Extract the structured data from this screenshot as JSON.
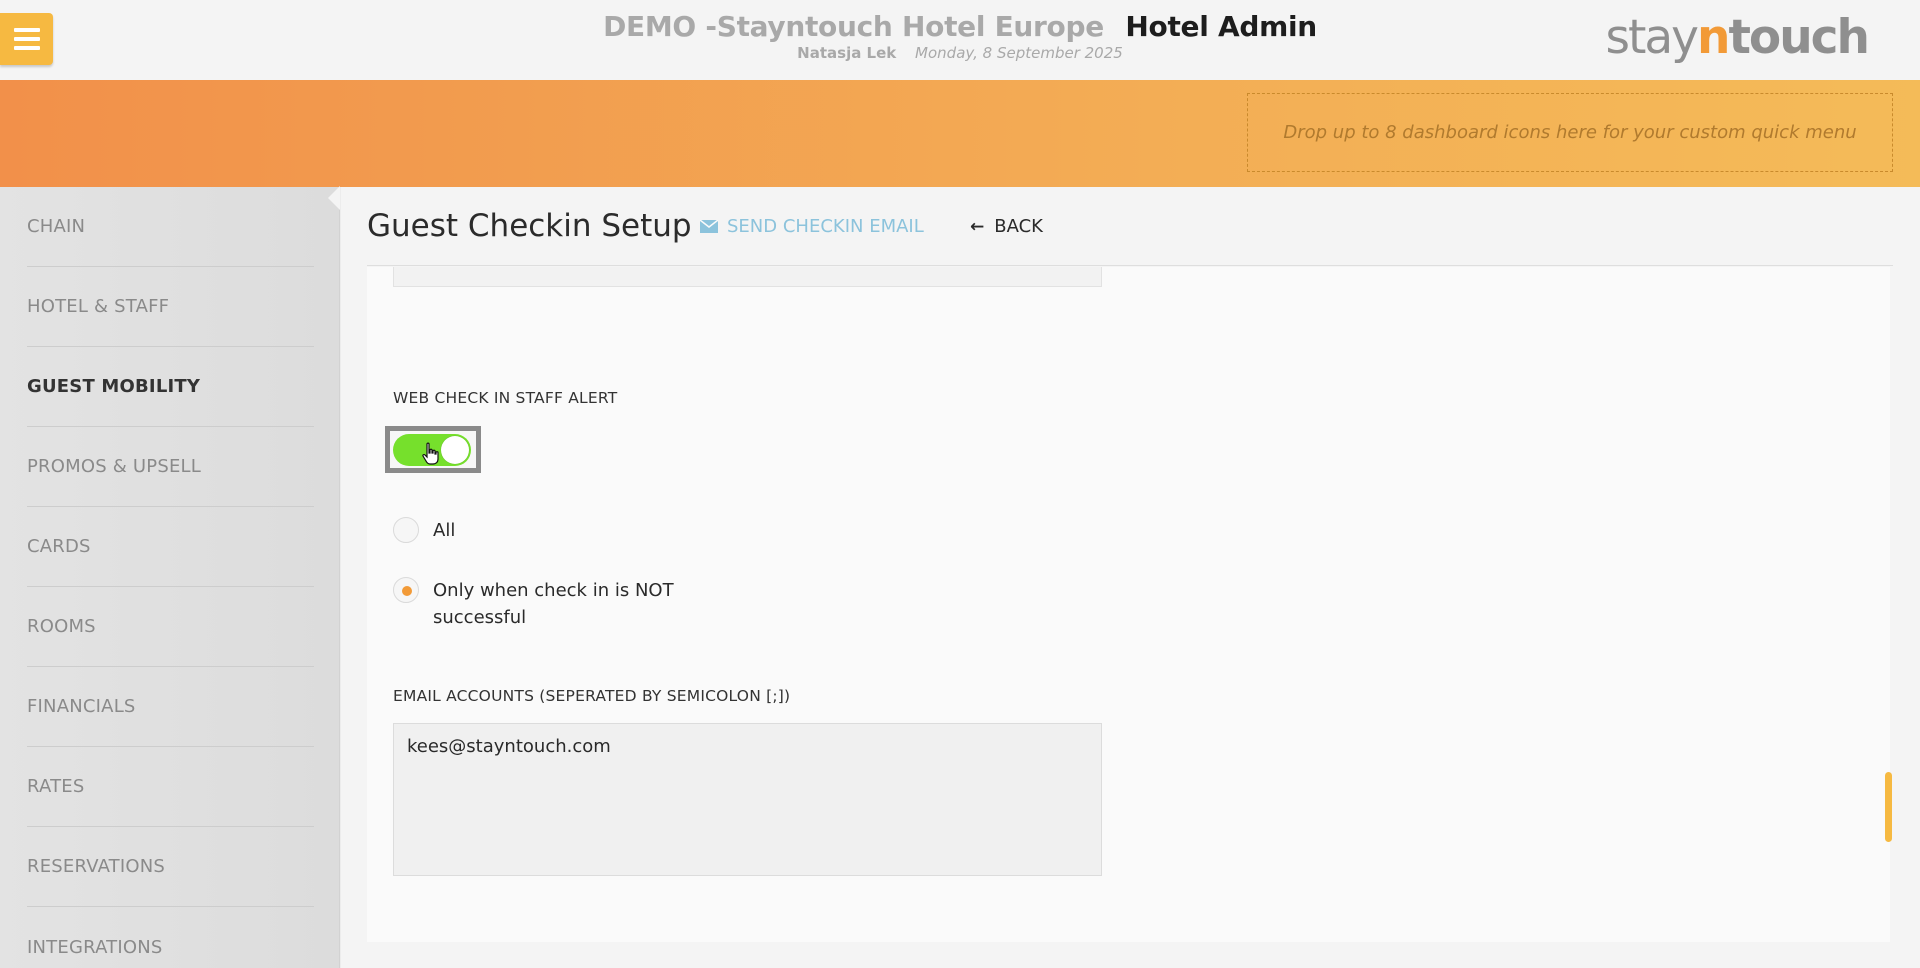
{
  "header": {
    "hotel_name": "DEMO -Stayntouch Hotel Europe",
    "app_name": "Hotel Admin",
    "user": "Natasja Lek",
    "date": "Monday, 8 September 2025",
    "logo": {
      "part1": "stay",
      "part2": "n",
      "part3": "touch"
    },
    "menu_icon": "hamburger-icon"
  },
  "banner": {
    "dropzone_text": "Drop up to 8 dashboard icons here for your custom quick menu"
  },
  "sidebar": {
    "items": [
      {
        "label": "CHAIN",
        "active": false
      },
      {
        "label": "HOTEL & STAFF",
        "active": false
      },
      {
        "label": "GUEST MOBILITY",
        "active": true
      },
      {
        "label": "PROMOS & UPSELL",
        "active": false
      },
      {
        "label": "CARDS",
        "active": false
      },
      {
        "label": "ROOMS",
        "active": false
      },
      {
        "label": "FINANCIALS",
        "active": false
      },
      {
        "label": "RATES",
        "active": false
      },
      {
        "label": "RESERVATIONS",
        "active": false
      },
      {
        "label": "INTEGRATIONS",
        "active": false
      }
    ]
  },
  "page": {
    "title": "Guest Checkin Setup",
    "send_email_label": "SEND CHECKIN EMAIL",
    "back_label": "BACK"
  },
  "form": {
    "staff_alert_label": "WEB CHECK IN STAFF ALERT",
    "staff_alert_enabled": true,
    "radio_all_label": "All",
    "radio_not_successful_label": "Only when check in is NOT successful",
    "selected_option": "not_successful",
    "email_accounts_label": "EMAIL ACCOUNTS (SEPERATED BY SEMICOLON [;])",
    "email_accounts_value": "kees@stayntouch.com"
  },
  "colors": {
    "accent_orange": "#f29a37",
    "menu_button": "#f6b941",
    "toggle_on": "#76e02c",
    "link_blue": "#8cc3dc"
  }
}
